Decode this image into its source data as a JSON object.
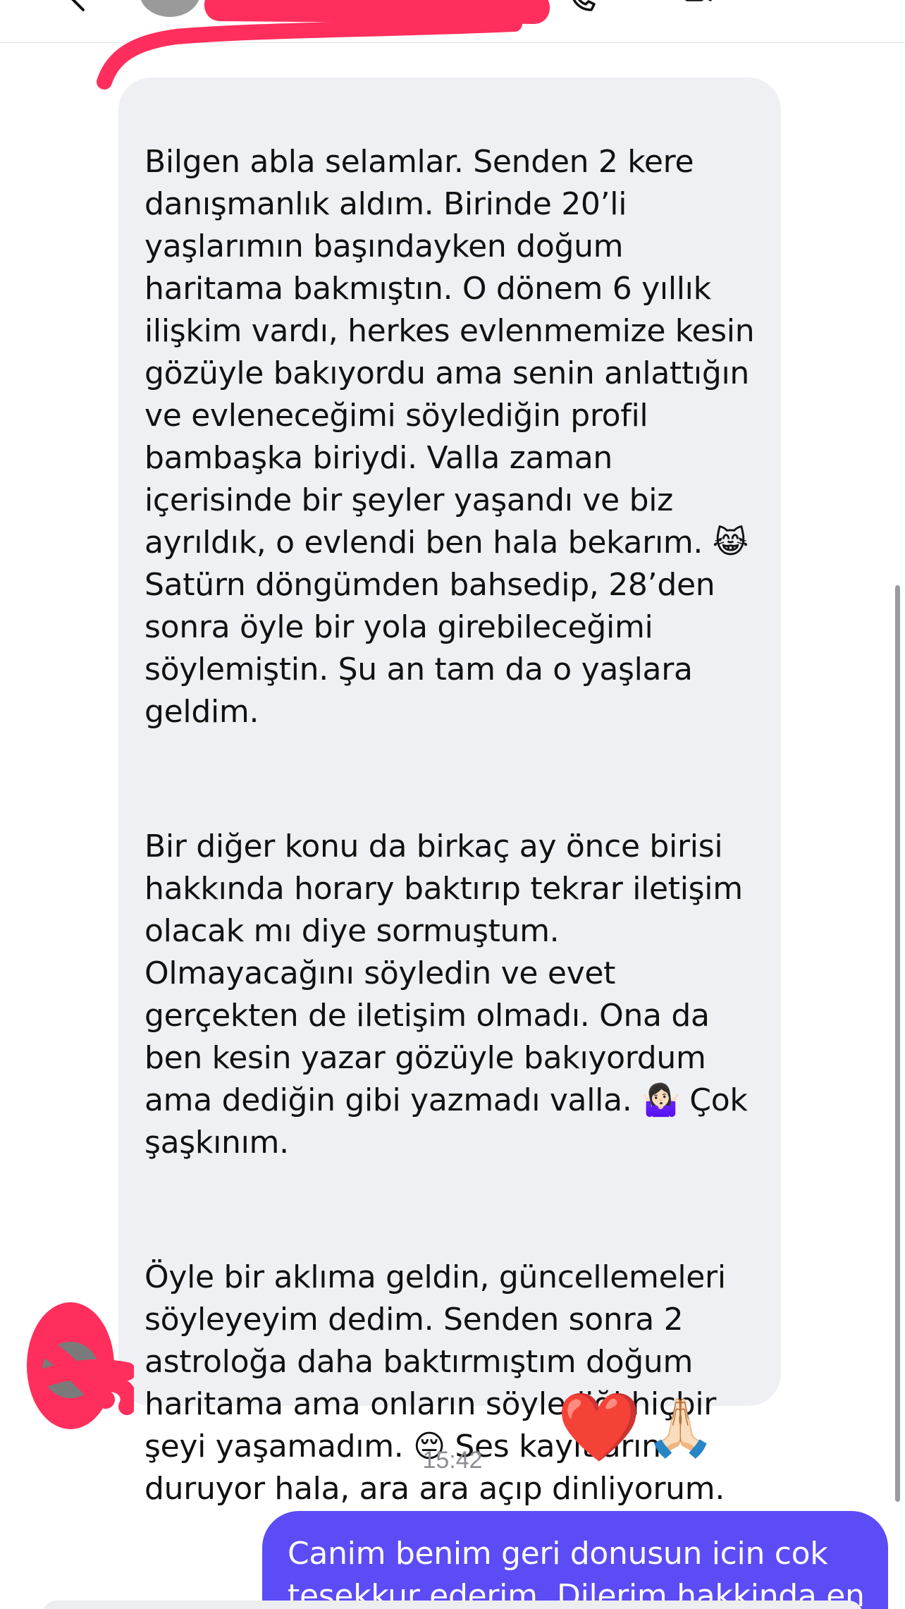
{
  "header": {
    "back_icon": "chevron-left-icon",
    "contact_name": "",
    "call_icon": "phone-icon",
    "video_icon": "video-icon",
    "info_icon": "flag-icon"
  },
  "messages": {
    "received": {
      "paragraphs": [
        "Bilgen abla selamlar. Senden 2 kere danışmanlık aldım. Birinde 20’li yaşlarımın başındayken doğum haritama bakmıştın. O dönem 6 yıllık ilişkim vardı, herkes evlenmemize kesin gözüyle bakıyordu ama senin anlattığın ve evleneceğimi söylediğin profil bambaşka biriydi. Valla zaman içerisinde bir şeyler yaşandı ve biz ayrıldık, o evlendi ben hala bekarım. 😹 Satürn döngümden bahsedip, 28’den sonra öyle bir yola girebileceğimi söylemiştin. Şu an tam da o yaşlara geldim.",
        "Bir diğer konu da birkaç ay önce birisi hakkında horary baktırıp tekrar iletişim olacak mı diye sormuştum. Olmayacağını söyledin ve evet gerçekten de iletişim olmadı. Ona da ben kesin yazar gözüyle bakıyordum ama dediğin gibi yazmadı valla. 🤷🏻‍♀️ Çok şaşkınım.",
        "Öyle bir aklıma geldin, güncellemeleri söyleyeyim dedim. Senden sonra 2 astroloğa daha baktırmıştım doğum haritama ama onların söylediği hiçbir şeyi yaşamadım. 😔 Ses kayıtların duruyor hala, ara ara açıp dinliyorum."
      ],
      "reactions": [
        "❤️",
        "🙏🏻"
      ]
    },
    "timestamp": "15:42",
    "sent": {
      "text": "Canim benim geri donusun icin cok tesekkur ederim. Dilerim hakkinda en"
    }
  },
  "colors": {
    "received_bubble": "#eff0f4",
    "sent_bubble": "#5b4cf5",
    "redaction": "#ff2e5c",
    "timestamp": "#8c8c94"
  }
}
